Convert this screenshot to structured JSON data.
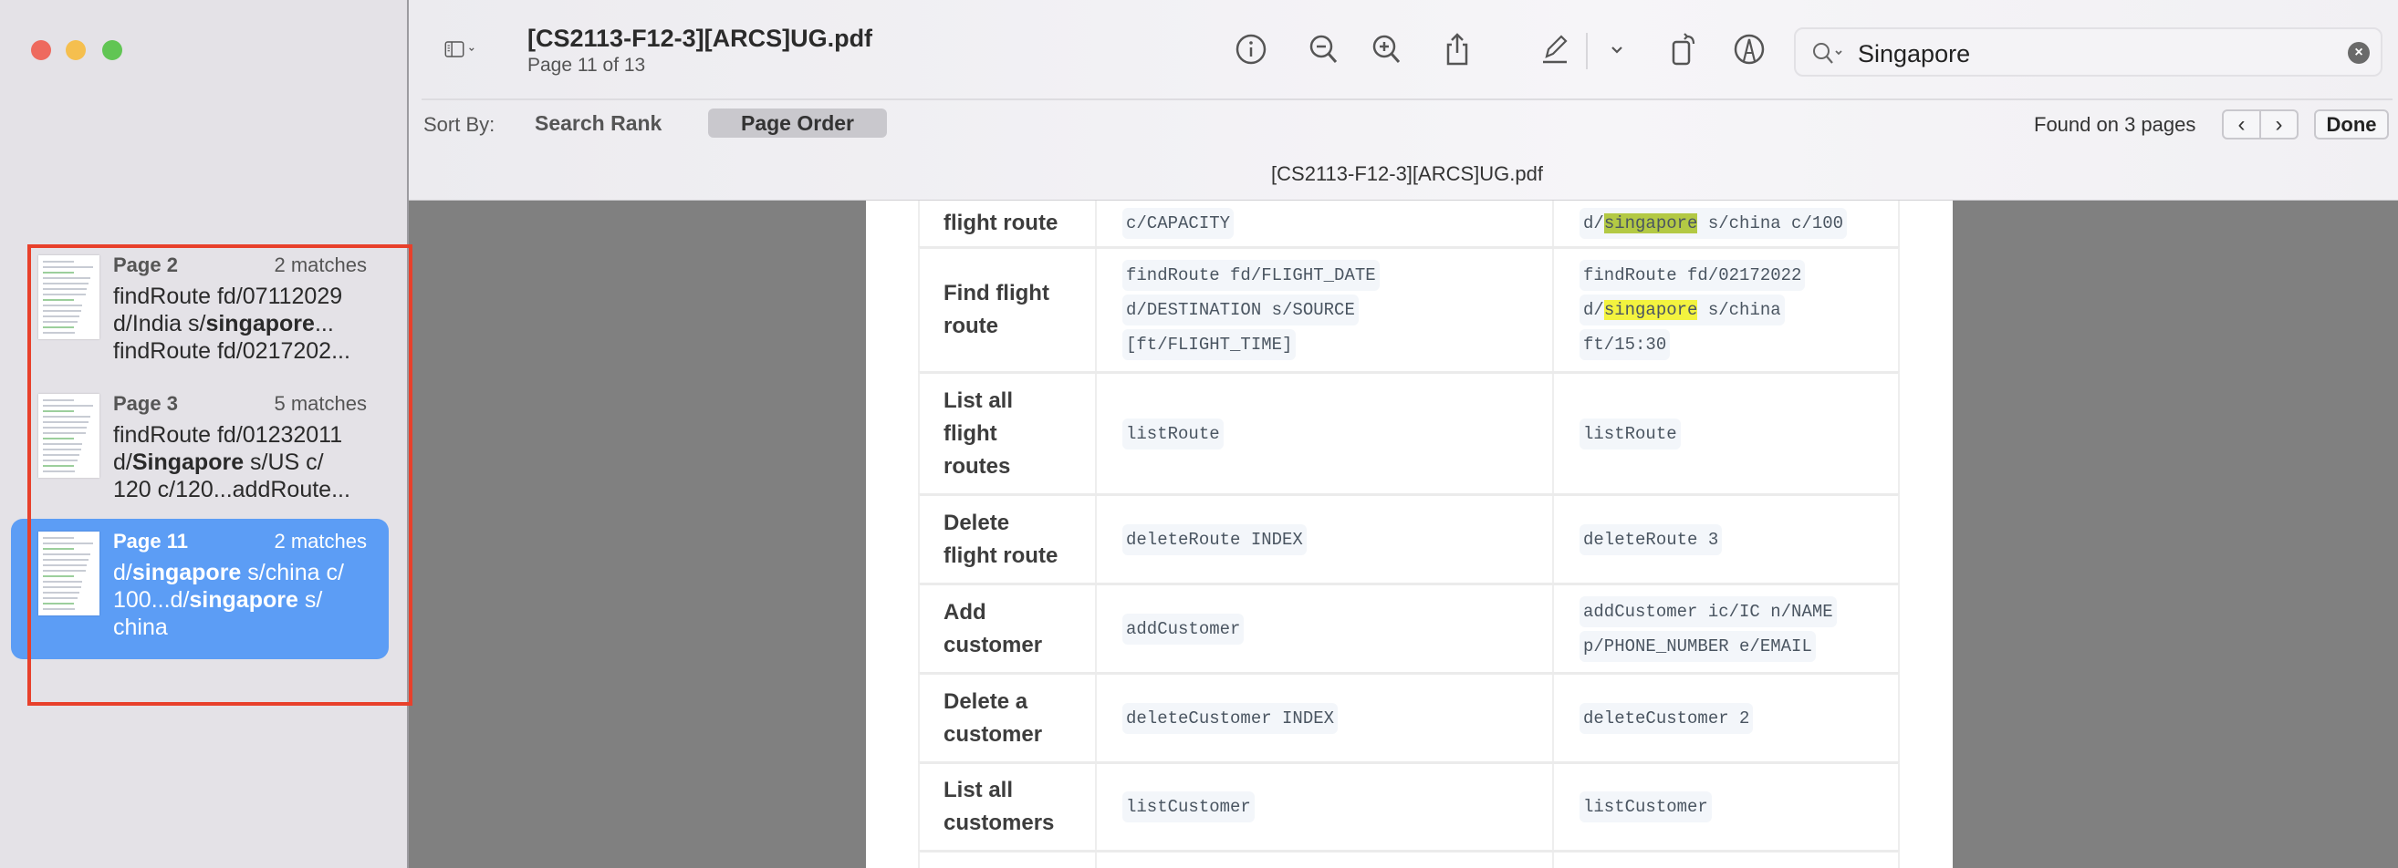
{
  "window": {
    "controls": {
      "close": "#ee6a5e",
      "minimize": "#f5bf4f",
      "zoom": "#61c554"
    }
  },
  "toolbar": {
    "title": "[CS2113-F12-3][ARCS]UG.pdf",
    "page_info": "Page 11 of 13",
    "icons": [
      "sidebar-toggle-icon",
      "info-icon",
      "zoom-out-icon",
      "zoom-in-icon",
      "share-icon",
      "highlight-pen-icon",
      "chevron-down-icon",
      "rotate-icon",
      "markup-icon"
    ],
    "search": {
      "value": "Singapore",
      "clear": "×"
    }
  },
  "findbar": {
    "sort_by_label": "Sort By:",
    "search_rank": "Search Rank",
    "page_order": "Page Order",
    "found": "Found on 3 pages",
    "prev": "‹",
    "next": "›",
    "done": "Done"
  },
  "document_title": "[CS2113-F12-3][ARCS]UG.pdf",
  "results": [
    {
      "page": "Page 2",
      "matches": "2 matches",
      "selected": false,
      "lines": [
        [
          {
            "t": "findRoute fd/07112029"
          }
        ],
        [
          {
            "t": "d/India s/"
          },
          {
            "t": "singapore",
            "b": true
          },
          {
            "t": "..."
          }
        ],
        [
          {
            "t": "findRoute fd/0217202..."
          }
        ]
      ]
    },
    {
      "page": "Page 3",
      "matches": "5 matches",
      "selected": false,
      "lines": [
        [
          {
            "t": "findRoute fd/01232011"
          }
        ],
        [
          {
            "t": "d/"
          },
          {
            "t": "Singapore",
            "b": true
          },
          {
            "t": " s/US c/"
          }
        ],
        [
          {
            "t": "120  c/120...addRoute..."
          }
        ]
      ]
    },
    {
      "page": "Page 11",
      "matches": "2 matches",
      "selected": true,
      "lines": [
        [
          {
            "t": "d/"
          },
          {
            "t": "singapore",
            "b": true
          },
          {
            "t": " s/china c/"
          }
        ],
        [
          {
            "t": "100...d/"
          },
          {
            "t": "singapore",
            "b": true
          },
          {
            "t": " s/"
          }
        ],
        [
          {
            "t": "china"
          }
        ]
      ]
    }
  ],
  "highlight_colors": {
    "current": "#b3c944",
    "other": "#f3f33f",
    "selection": "#5c9df5",
    "annotation_box": "#e8402b"
  },
  "table": {
    "rows": [
      {
        "label": [
          "flight route"
        ],
        "format": [
          [
            {
              "t": "c/CAPACITY"
            }
          ]
        ],
        "example": [
          [
            {
              "t": "d/"
            },
            {
              "t": "singapore",
              "hl": "current"
            },
            {
              "t": " s/china c/100"
            }
          ]
        ]
      },
      {
        "label": [
          "Find flight",
          "route"
        ],
        "format": [
          [
            {
              "t": "findRoute fd/FLIGHT_DATE"
            }
          ],
          [
            {
              "t": "d/DESTINATION s/SOURCE"
            }
          ],
          [
            {
              "t": "[ft/FLIGHT_TIME]"
            }
          ]
        ],
        "example": [
          [
            {
              "t": "findRoute fd/02172022"
            }
          ],
          [
            {
              "t": "d/"
            },
            {
              "t": "singapore",
              "hl": "other"
            },
            {
              "t": " s/china"
            }
          ],
          [
            {
              "t": "ft/15:30"
            }
          ]
        ]
      },
      {
        "label": [
          "List all",
          "flight",
          "routes"
        ],
        "format": [
          [
            {
              "t": "listRoute"
            }
          ]
        ],
        "example": [
          [
            {
              "t": "listRoute"
            }
          ]
        ]
      },
      {
        "label": [
          "Delete",
          "flight route"
        ],
        "format": [
          [
            {
              "t": "deleteRoute INDEX"
            }
          ]
        ],
        "example": [
          [
            {
              "t": "deleteRoute 3"
            }
          ]
        ]
      },
      {
        "label": [
          "Add",
          "customer"
        ],
        "format": [
          [
            {
              "t": "addCustomer"
            }
          ]
        ],
        "example": [
          [
            {
              "t": "addCustomer ic/IC n/NAME"
            }
          ],
          [
            {
              "t": "p/PHONE_NUMBER e/EMAIL"
            }
          ]
        ]
      },
      {
        "label": [
          "Delete a",
          "customer"
        ],
        "format": [
          [
            {
              "t": "deleteCustomer INDEX"
            }
          ]
        ],
        "example": [
          [
            {
              "t": "deleteCustomer 2"
            }
          ]
        ]
      },
      {
        "label": [
          "List all",
          "customers"
        ],
        "format": [
          [
            {
              "t": "listCustomer"
            }
          ]
        ],
        "example": [
          [
            {
              "t": "listCustomer"
            }
          ]
        ]
      },
      {
        "label": [],
        "format": [],
        "example": []
      }
    ]
  }
}
